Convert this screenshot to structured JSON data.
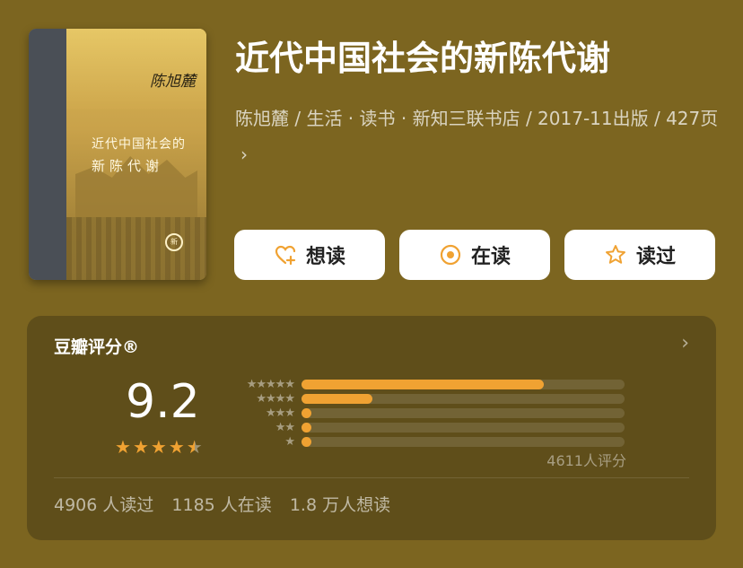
{
  "book": {
    "title": "近代中国社会的新陈代谢",
    "meta": "陈旭麓 / 生活 · 读书 · 新知三联书店 / 2017-11出版 / 427页",
    "cover": {
      "author_signature": "陈旭麓",
      "title_line1": "近代中国社会的",
      "title_line2": "新陈代谢",
      "publisher_logo": "新"
    }
  },
  "actions": [
    {
      "label": "想读",
      "icon": "heart-plus-icon"
    },
    {
      "label": "在读",
      "icon": "target-circle-icon"
    },
    {
      "label": "读过",
      "icon": "star-outline-icon"
    }
  ],
  "rating": {
    "title": "豆瓣评分®",
    "score": "9.2",
    "stars_filled": 4.5,
    "distribution": [
      {
        "stars": 5,
        "label": "★★★★★",
        "fraction": 0.75
      },
      {
        "stars": 4,
        "label": "★★★★",
        "fraction": 0.22
      },
      {
        "stars": 3,
        "label": "★★★",
        "fraction": 0.03
      },
      {
        "stars": 2,
        "label": "★★",
        "fraction": 0.03
      },
      {
        "stars": 1,
        "label": "★",
        "fraction": 0.03
      }
    ],
    "count_text": "4611人评分",
    "stats": [
      "4906 人读过",
      "1185 人在读",
      "1.8 万人想读"
    ]
  },
  "colors": {
    "accent": "#f0a232",
    "background": "#7c6520"
  }
}
